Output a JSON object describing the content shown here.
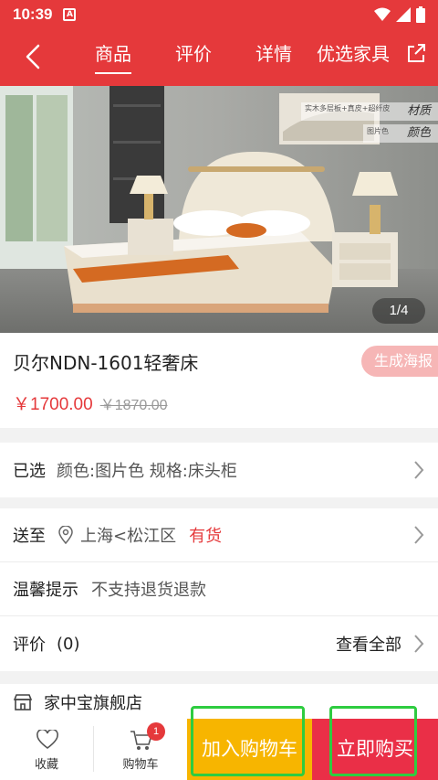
{
  "status": {
    "time": "10:39",
    "a_badge": "A"
  },
  "nav": {
    "tabs": [
      "商品",
      "评价",
      "详情",
      "优选家具"
    ],
    "active_tab": 0
  },
  "hero": {
    "counter": "1/4",
    "label_material": "材质",
    "label_color": "颜色",
    "label_material_small": "实木多层板+真皮+超纤皮",
    "label_color_small": "图片色"
  },
  "product": {
    "title": "贝尔NDN-1601轻奢床",
    "poster_button": "生成海报",
    "price_now": "￥1700.00",
    "price_old": "￥1870.00"
  },
  "selected": {
    "label": "已选",
    "value": "颜色:图片色 规格:床头柜"
  },
  "delivery": {
    "label": "送至",
    "location": "上海<松江区",
    "stock": "有货"
  },
  "notice": {
    "label": "温馨提示",
    "value": "不支持退货退款"
  },
  "reviews": {
    "label": "评价",
    "count": "(0)",
    "view_all": "查看全部"
  },
  "store": {
    "name": "家中宝旗舰店"
  },
  "bottom": {
    "favorite": "收藏",
    "cart": "购物车",
    "cart_count": "1",
    "add_to_cart": "加入购物车",
    "buy_now": "立即购买"
  },
  "colors": {
    "brand_red": "#e5393b",
    "add_cart_yellow": "#f7b500",
    "buy_now_red": "#ea2f47",
    "highlight_green": "#2ecc40"
  }
}
